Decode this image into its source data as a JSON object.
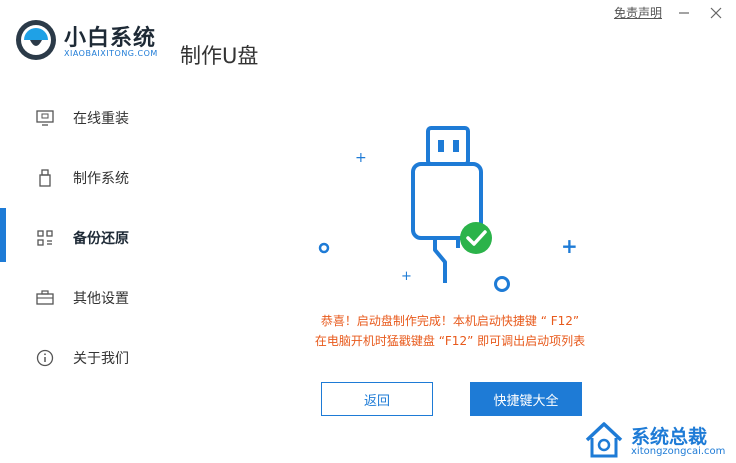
{
  "app": {
    "logo_name": "小白系统",
    "logo_subtitle": "XIAOBAIXITONG.COM",
    "page_title": "制作U盘"
  },
  "topbar": {
    "disclaimer_link": "免责声明"
  },
  "sidebar": {
    "items": [
      {
        "label": "在线重装",
        "icon": "monitor-icon"
      },
      {
        "label": "制作系统",
        "icon": "usb-drive-icon"
      },
      {
        "label": "备份还原",
        "icon": "backup-grid-icon",
        "active": true
      },
      {
        "label": "其他设置",
        "icon": "briefcase-icon"
      },
      {
        "label": "关于我们",
        "icon": "info-icon"
      }
    ]
  },
  "main": {
    "message_line1": "恭喜！启动盘制作完成！本机启动快捷键 “ F12”",
    "message_line2": "在电脑开机时猛戳键盘 “F12” 即可调出启动项列表",
    "back_button": "返回",
    "hotkeys_button": "快捷键大全"
  },
  "watermark": {
    "name": "系统总裁",
    "url": "xitongzongcai.com"
  },
  "colors": {
    "accent": "#1e7bd6",
    "message": "#e85a1c",
    "success": "#2bb34a"
  }
}
